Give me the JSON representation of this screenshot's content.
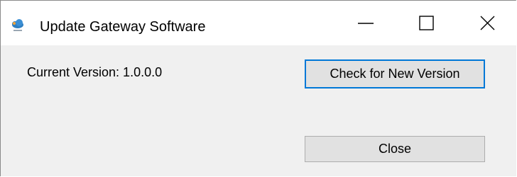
{
  "window": {
    "title": "Update Gateway Software",
    "icon": "cloud-gateway-icon",
    "caption_buttons": [
      "minimize-icon",
      "maximize-icon",
      "close-icon"
    ]
  },
  "main": {
    "version_label": "Current Version: 1.0.0.0",
    "check_button_label": "Check for New Version",
    "close_button_label": "Close"
  },
  "colors": {
    "focus_border": "#0078d7",
    "button_face": "#e1e1e1",
    "client_background": "#f0f0f0"
  }
}
